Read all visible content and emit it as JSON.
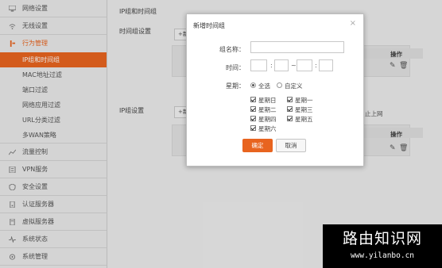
{
  "sidebar": {
    "items_top": [
      {
        "label": "网络设置",
        "icon": "network-icon"
      },
      {
        "label": "无线设置",
        "icon": "wifi-icon"
      },
      {
        "label": "行为管理",
        "icon": "behavior-icon"
      }
    ],
    "sub_items": [
      "IP组和时间组",
      "MAC地址过滤",
      "端口过滤",
      "网络应用过滤",
      "URL分类过滤",
      "多WAN策略"
    ],
    "items_bottom": [
      {
        "label": "流量控制",
        "icon": "traffic-icon"
      },
      {
        "label": "VPN服务",
        "icon": "vpn-icon"
      },
      {
        "label": "安全设置",
        "icon": "security-icon"
      },
      {
        "label": "认证服务器",
        "icon": "auth-icon"
      },
      {
        "label": "虚拟服务器",
        "icon": "server-icon"
      },
      {
        "label": "系统状态",
        "icon": "status-icon"
      },
      {
        "label": "系统管理",
        "icon": "admin-icon"
      }
    ]
  },
  "main": {
    "breadcrumb": "IP组和时间组",
    "time_group_title": "时间组设置",
    "ip_group_title": "IP组设置",
    "add_label": "+新",
    "op_header": "操作",
    "hint_fragment": "止上网"
  },
  "dialog": {
    "title": "新增时间组",
    "close": "×",
    "name_label": "组名称：",
    "name_value": "",
    "time_label": "时间：",
    "colon": ":",
    "tilde": "~",
    "week_label": "星期：",
    "radio_all": "全选",
    "radio_custom": "自定义",
    "days": [
      "星期日",
      "星期一",
      "星期二",
      "星期三",
      "星期四",
      "星期五",
      "星期六"
    ],
    "ok": "确定",
    "cancel": "取消"
  },
  "watermark": {
    "title": "路由知识网",
    "url": "www.yilanbo.cn"
  },
  "colors": {
    "accent": "#e8641f"
  }
}
